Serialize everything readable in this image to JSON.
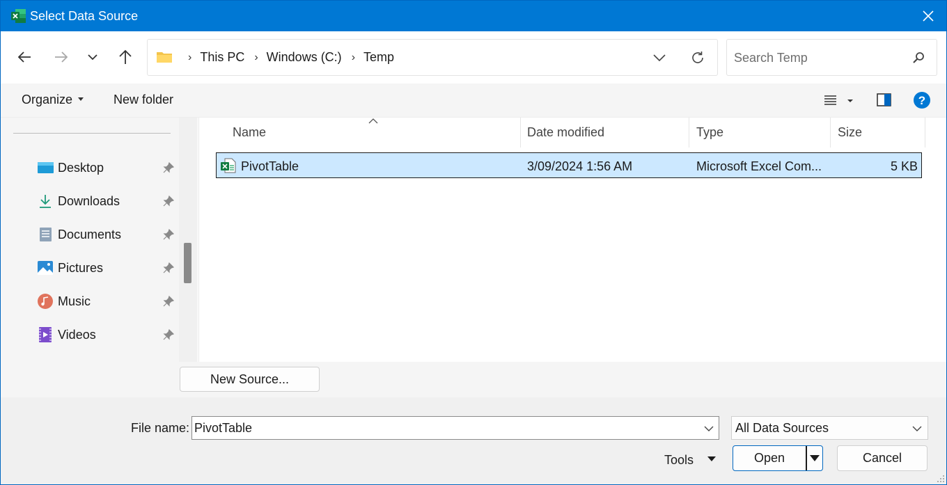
{
  "window": {
    "title": "Select Data Source",
    "app_icon": "excel-icon",
    "accent_color": "#0078d4"
  },
  "nav": {
    "back_icon": "arrow-left-icon",
    "forward_icon": "arrow-right-icon",
    "recent_icon": "chevron-down-icon",
    "up_icon": "arrow-up-icon"
  },
  "address": {
    "crumbs": [
      "This PC",
      "Windows (C:)",
      "Temp"
    ],
    "refresh_icon": "refresh-icon"
  },
  "search": {
    "placeholder": "Search Temp",
    "value": ""
  },
  "toolbar": {
    "organize_label": "Organize",
    "new_folder_label": "New folder"
  },
  "sidebar": {
    "items": [
      {
        "label": "Desktop",
        "icon": "desktop-icon"
      },
      {
        "label": "Downloads",
        "icon": "download-icon"
      },
      {
        "label": "Documents",
        "icon": "document-icon"
      },
      {
        "label": "Pictures",
        "icon": "pictures-icon"
      },
      {
        "label": "Music",
        "icon": "music-icon"
      },
      {
        "label": "Videos",
        "icon": "video-icon"
      }
    ]
  },
  "filelist": {
    "columns": [
      "Name",
      "Date modified",
      "Type",
      "Size"
    ],
    "rows": [
      {
        "name": "PivotTable",
        "date": "3/09/2024 1:56 AM",
        "type": "Microsoft Excel Com...",
        "size": "5 KB",
        "selected": true
      }
    ]
  },
  "source": {
    "new_source_label": "New Source..."
  },
  "footer": {
    "file_name_label": "File name:",
    "file_name_value": "PivotTable",
    "filter_value": "All Data Sources",
    "tools_label": "Tools",
    "open_label": "Open",
    "cancel_label": "Cancel"
  }
}
